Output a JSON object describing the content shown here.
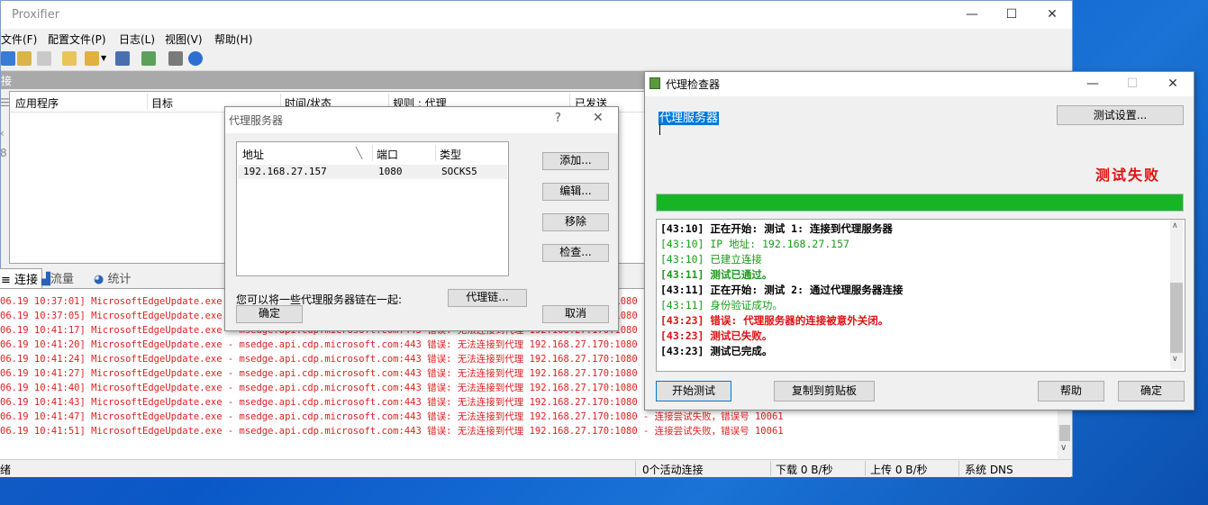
{
  "main": {
    "title": "Proxifier",
    "menu": [
      "文件(F)",
      "配置文件(P)",
      "日志(L)",
      "视图(V)",
      "帮助(H)"
    ],
    "section_label": "接",
    "columns": [
      "应用程序",
      "目标",
      "时间/状态",
      "规则 : 代理",
      "已发送"
    ],
    "tabs": [
      "连接",
      "流量",
      "统计"
    ],
    "log_lines": [
      "06.19 10:37:01] MicrosoftEdgeUpdate.exe - msedge.api.cdp.microsoft.com:443 错误: 无法连接到代理 192.168.27.170:1080 - 连",
      "06.19 10:37:05] MicrosoftEdgeUpdate.exe - msedge.api.cdp.microsoft.com:443 错误: 无法连接到代理 192.168.27.170:1080 - 连",
      "06.19 10:41:17] MicrosoftEdgeUpdate.exe - msedge.api.cdp.microsoft.com:443 错误: 无法连接到代理 192.168.27.170:1080 - 连",
      "06.19 10:41:20] MicrosoftEdgeUpdate.exe - msedge.api.cdp.microsoft.com:443 错误: 无法连接到代理 192.168.27.170:1080 - 连",
      "06.19 10:41:24] MicrosoftEdgeUpdate.exe - msedge.api.cdp.microsoft.com:443 错误: 无法连接到代理 192.168.27.170:1080 - 连",
      "06.19 10:41:27] MicrosoftEdgeUpdate.exe - msedge.api.cdp.microsoft.com:443 错误: 无法连接到代理 192.168.27.170:1080 - 连",
      "06.19 10:41:40] MicrosoftEdgeUpdate.exe - msedge.api.cdp.microsoft.com:443 错误: 无法连接到代理 192.168.27.170:1080 - 连",
      "06.19 10:41:43] MicrosoftEdgeUpdate.exe - msedge.api.cdp.microsoft.com:443 错误: 无法连接到代理 192.168.27.170:1080 - 连",
      "06.19 10:41:47] MicrosoftEdgeUpdate.exe - msedge.api.cdp.microsoft.com:443 错误: 无法连接到代理 192.168.27.170:1080 - 连接尝试失败，错误号 10061",
      "06.19 10:41:51] MicrosoftEdgeUpdate.exe - msedge.api.cdp.microsoft.com:443 错误: 无法连接到代理 192.168.27.170:1080 - 连接尝试失败，错误号 10061"
    ],
    "status": {
      "ready": "绪",
      "active": "0个活动连接",
      "download": "下载 0 B/秒",
      "upload": "上传 0 B/秒",
      "dns": "系统 DNS"
    }
  },
  "proxy_dialog": {
    "title": "代理服务器",
    "help": "?",
    "columns": [
      "地址",
      "端口",
      "类型"
    ],
    "row": {
      "address": "192.168.27.157",
      "port": "1080",
      "type": "SOCKS5"
    },
    "buttons": {
      "add": "添加...",
      "edit": "编辑...",
      "remove": "移除",
      "check": "检查...",
      "chain": "代理链...",
      "ok": "确定",
      "cancel": "取消"
    },
    "chain_text": "您可以将一些代理服务器链在一起:"
  },
  "checker": {
    "title": "代理检查器",
    "target_value": "代理服务器",
    "settings_button": "测试设置...",
    "result": "测试失败",
    "result_color": "#e01010",
    "progress_color": "#17b526",
    "progress": 100,
    "log": [
      {
        "text": "[43:10] 正在开始: 测试 1: 连接到代理服务器",
        "style": "black"
      },
      {
        "text": "[43:10] IP 地址: 192.168.27.157",
        "style": "green"
      },
      {
        "text": "[43:10] 已建立连接",
        "style": "green"
      },
      {
        "text": "[43:11] 测试已通过。",
        "style": "gbold"
      },
      {
        "text": "[43:11] 正在开始: 测试 2: 通过代理服务器连接",
        "style": "black"
      },
      {
        "text": "[43:11] 身份验证成功。",
        "style": "green"
      },
      {
        "text": "[43:23] 错误: 代理服务器的连接被意外关闭。",
        "style": "red"
      },
      {
        "text": "[43:23] 测试已失败。",
        "style": "red"
      },
      {
        "text": "[43:23] 测试已完成。",
        "style": "black"
      }
    ],
    "buttons": {
      "start": "开始测试",
      "copy": "复制到剪贴板",
      "help": "帮助",
      "ok": "确定"
    }
  }
}
